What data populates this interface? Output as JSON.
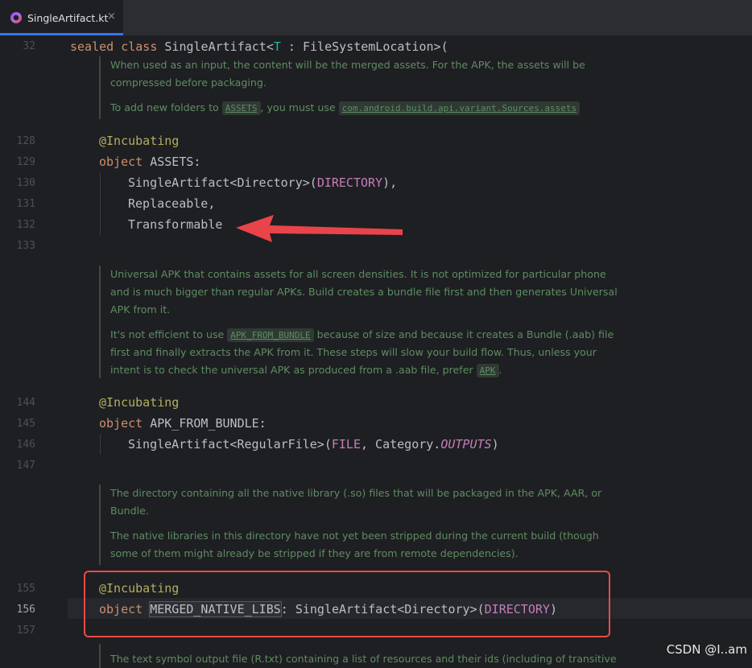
{
  "tab": {
    "file_name": "SingleArtifact.kt",
    "close_glyph": "×",
    "icon": "kotlin-file-icon"
  },
  "line_numbers": {
    "l32": "32",
    "l128": "128",
    "l129": "129",
    "l130": "130",
    "l131": "131",
    "l132": "132",
    "l133": "133",
    "l144": "144",
    "l145": "145",
    "l146": "146",
    "l147": "147",
    "l155": "155",
    "l156": "156",
    "l157": "157"
  },
  "code": {
    "l32_kw1": "sealed",
    "l32_kw2": "class",
    "l32_name": "SingleArtifact<",
    "l32_tparam": "T",
    "l32_rest": " : FileSystemLocation>(",
    "ann": "@Incubating",
    "kw_object": "object",
    "assets_decl": " ASSETS:",
    "assets_l1a": "SingleArtifact<Directory>(",
    "assets_l1b": "DIRECTORY",
    "assets_l1c": "),",
    "assets_l2": "Replaceable,",
    "assets_l3": "Transformable",
    "apk_decl": " APK_FROM_BUNDLE:",
    "apk_l1a": "SingleArtifact<RegularFile>(",
    "apk_l1b": "FILE",
    "apk_l1c": ", Category.",
    "apk_l1d": "OUTPUTS",
    "apk_l1e": ")",
    "libs_space": " ",
    "libs_name": "MERGED_NATIVE_LIBS",
    "libs_a": ": SingleArtifact<Directory>(",
    "libs_b": "DIRECTORY",
    "libs_c": ")"
  },
  "docs": {
    "assets_p1": "When used as an input, the content will be the merged assets. For the APK, the assets will be compressed before packaging.",
    "assets_p2_a": "To add new folders to ",
    "assets_p2_chip1": "ASSETS",
    "assets_p2_b": ", you must use ",
    "assets_p2_chip2": "com.android.build.api.variant.Sources.assets",
    "apk_p1": "Universal APK that contains assets for all screen densities. It is not optimized for particular phone and is much bigger than regular APKs. Build creates a bundle file first and then generates Universal APK from it.",
    "apk_p2_a": "It's not efficient to use ",
    "apk_p2_chip1": "APK_FROM_BUNDLE",
    "apk_p2_b": " because of size and because it creates a Bundle (.aab) file first and finally extracts the APK from it. These steps will slow your build flow. Thus, unless your intent is to check the universal APK as produced from a .aab file, prefer ",
    "apk_p2_chip2": "APK",
    "apk_p2_c": ".",
    "libs_p1": "The directory containing all the native library (.so) files that will be packaged in the APK, AAR, or Bundle.",
    "libs_p2": "The native libraries in this directory have not yet been stripped during the current build (though some of them might already be stripped if they are from remote dependencies).",
    "next_p1": "The text symbol output file (R.txt) containing a list of resources and their ids (including of transitive"
  },
  "watermark": "CSDN @I..am",
  "colors": {
    "keyword": "#cf8e6d",
    "annotation": "#b3ae60",
    "constant": "#c77dbb",
    "doc": "#5f8c63",
    "highlight_box": "#ea4a45",
    "arrow": "#e8444a"
  }
}
